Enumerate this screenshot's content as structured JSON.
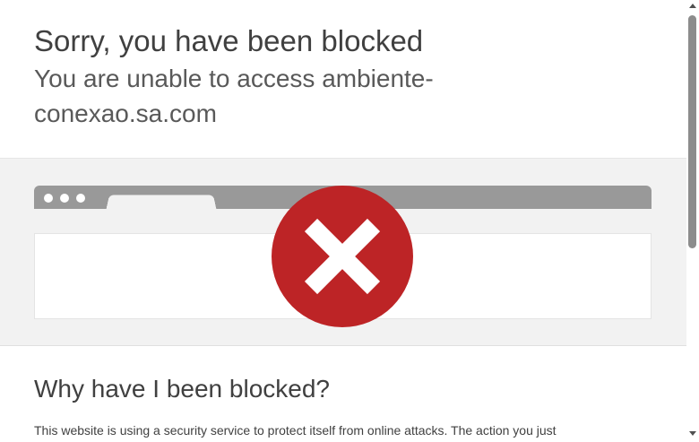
{
  "header": {
    "title": "Sorry, you have been blocked",
    "subtitle": "You are unable to access ambiente-conexao.sa.com"
  },
  "illustration": {
    "icon": "blocked-x-icon",
    "icon_color": "#bd2426",
    "bar_color": "#999999"
  },
  "why_section": {
    "title": "Why have I been blocked?",
    "text": "This website is using a security service to protect itself from online attacks. The action you just"
  },
  "scrollbar": {
    "up_icon": "scroll-up-arrow-icon",
    "down_icon": "scroll-down-arrow-icon"
  }
}
